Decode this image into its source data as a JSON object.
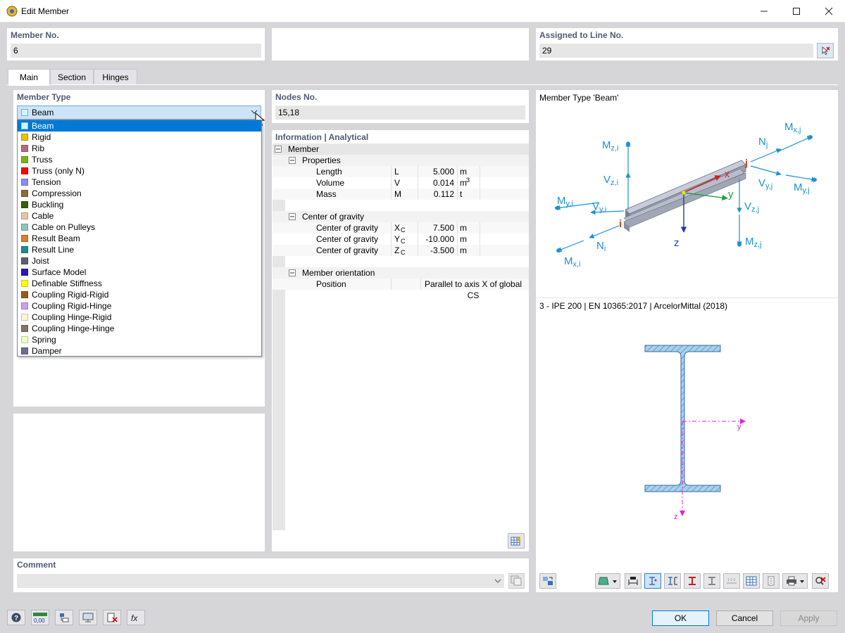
{
  "window": {
    "title": "Edit Member"
  },
  "header": {
    "member_no_label": "Member No.",
    "member_no_value": "6",
    "assigned_label": "Assigned to Line No.",
    "assigned_value": "29"
  },
  "tabs": [
    "Main",
    "Section",
    "Hinges"
  ],
  "member_type": {
    "label": "Member Type",
    "selected": "Beam",
    "options": [
      {
        "label": "Beam",
        "color": "#ccf5ff"
      },
      {
        "label": "Rigid",
        "color": "#e6c300"
      },
      {
        "label": "Rib",
        "color": "#b36b80"
      },
      {
        "label": "Truss",
        "color": "#7ab317"
      },
      {
        "label": "Truss (only N)",
        "color": "#ff0000"
      },
      {
        "label": "Tension",
        "color": "#8a8aff"
      },
      {
        "label": "Compression",
        "color": "#8c6b3a"
      },
      {
        "label": "Buckling",
        "color": "#3a5c0f"
      },
      {
        "label": "Cable",
        "color": "#e8c4a8"
      },
      {
        "label": "Cable on Pulleys",
        "color": "#8fc6c2"
      },
      {
        "label": "Result Beam",
        "color": "#e07b30"
      },
      {
        "label": "Result Line",
        "color": "#238c8c"
      },
      {
        "label": "Joist",
        "color": "#606070"
      },
      {
        "label": "Surface Model",
        "color": "#2a1ab3"
      },
      {
        "label": "Definable Stiffness",
        "color": "#ffff00"
      },
      {
        "label": "Coupling Rigid-Rigid",
        "color": "#9c5a14"
      },
      {
        "label": "Coupling Rigid-Hinge",
        "color": "#c9a0f0"
      },
      {
        "label": "Coupling Hinge-Rigid",
        "color": "#fff5d6"
      },
      {
        "label": "Coupling Hinge-Hinge",
        "color": "#857560"
      },
      {
        "label": "Spring",
        "color": "#efffc0"
      },
      {
        "label": "Damper",
        "color": "#6a6f8c"
      }
    ]
  },
  "nodes": {
    "label": "Nodes No.",
    "value": "15,18"
  },
  "info": {
    "label": "Information | Analytical",
    "member": "Member",
    "properties": "Properties",
    "rows_props": [
      {
        "name": "Length",
        "sym": "L",
        "val": "5.000",
        "unit": "m"
      },
      {
        "name": "Volume",
        "sym": "V",
        "val": "0.014",
        "unit": "m",
        "sup": "3"
      },
      {
        "name": "Mass",
        "sym": "M",
        "val": "0.112",
        "unit": "t"
      }
    ],
    "cog": "Center of gravity",
    "rows_cog": [
      {
        "name": "Center of gravity",
        "sym": "X",
        "sub": "C",
        "val": "7.500",
        "unit": "m"
      },
      {
        "name": "Center of gravity",
        "sym": "Y",
        "sub": "C",
        "val": "-10.000",
        "unit": "m"
      },
      {
        "name": "Center of gravity",
        "sym": "Z",
        "sub": "C",
        "val": "-3.500",
        "unit": "m"
      }
    ],
    "orient": "Member orientation",
    "pos_name": "Position",
    "pos_val": "Parallel to axis X of global CS"
  },
  "diagram": {
    "title": "Member Type 'Beam'",
    "labels": {
      "mzi_m": "M",
      "mzi_s": "z,i",
      "vzi_m": "V",
      "vzi_s": "z,i",
      "myi_m": "M",
      "myi_s": "y,i",
      "vyi_m": "V",
      "vyi_s": "y,i",
      "ni_m": "N",
      "ni_s": "i",
      "mxi_m": "M",
      "mxi_s": "x,i",
      "mxj_m": "M",
      "mxj_s": "x,j",
      "nj_m": "N",
      "nj_s": "j",
      "vyj_m": "V",
      "vyj_s": "y,j",
      "myj_m": "M",
      "myj_s": "y,j",
      "vzj_m": "V",
      "vzj_s": "z,j",
      "mzj_m": "M",
      "mzj_s": "z,j",
      "i": "i",
      "j": "j",
      "x": "x",
      "y": "y",
      "z": "z"
    }
  },
  "section": {
    "title": "3 - IPE 200 | EN 10365:2017 | ArcelorMittal (2018)",
    "y": "y",
    "z": "z"
  },
  "comment": {
    "label": "Comment",
    "value": ""
  },
  "buttons": {
    "ok": "OK",
    "cancel": "Cancel",
    "apply": "Apply"
  },
  "bottom_tools": {
    "units": "0,00"
  },
  "colors": {
    "label": "#4f5b75",
    "arrow": "#1a8fd6",
    "accent": "#0078d7"
  }
}
